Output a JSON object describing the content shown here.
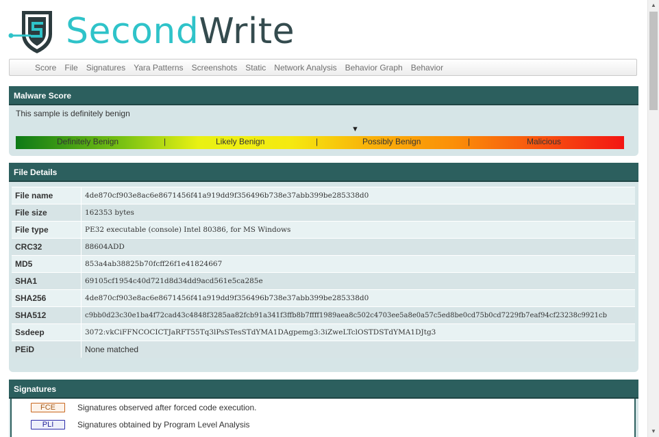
{
  "logo": {
    "part1": "Second",
    "part2": "Write"
  },
  "nav": {
    "items": [
      "Score",
      "File",
      "Signatures",
      "Yara Patterns",
      "Screenshots",
      "Static",
      "Network Analysis",
      "Behavior Graph",
      "Behavior"
    ]
  },
  "malware_score": {
    "title": "Malware Score",
    "summary": "This sample is definitely benign",
    "marker": "▼",
    "levels": [
      "Definitely Benign",
      "Likely Benign",
      "Possibly Benign",
      "Malicious"
    ],
    "separator": "|",
    "colors": {
      "start": "#0d7a16",
      "mid": "#f5ea10",
      "end": "#f31513"
    }
  },
  "file_details": {
    "title": "File Details",
    "rows": [
      {
        "key": "File name",
        "value": "4de870cf903e8ac6e8671456f41a919dd9f356496b738e37abb399be285338d0"
      },
      {
        "key": "File size",
        "value": "162353 bytes"
      },
      {
        "key": "File type",
        "value": "PE32 executable (console) Intel 80386, for MS Windows"
      },
      {
        "key": "CRC32",
        "value": "88604ADD"
      },
      {
        "key": "MD5",
        "value": "853a4ab38825b70fcff26f1e41824667"
      },
      {
        "key": "SHA1",
        "value": "69105cf1954c40d721d8d34dd9acd561e5ca285e"
      },
      {
        "key": "SHA256",
        "value": "4de870cf903e8ac6e8671456f41a919dd9f356496b738e37abb399be285338d0"
      },
      {
        "key": "SHA512",
        "value": "c9bb0d23c30e1ba4f72cad43c4848f3285aa82fcb91a341f3ffb8b7ffff1989aea8c502c4703ee5a8e0a57c5ed8be0cd75b0cd7229fb7eaf94cf23238c9921cb"
      },
      {
        "key": "Ssdeep",
        "value": "3072:vkCiFFNCOCICTJaRFT55Tq3lPsSTesSTdYMA1DAgpemg3:3iZweLTclOSTDSTdYMA1DJtg3"
      },
      {
        "key": "PEiD",
        "value": "None matched"
      }
    ]
  },
  "signatures": {
    "title": "Signatures",
    "legend": [
      {
        "badge": "FCE",
        "desc": "Signatures observed after forced code execution."
      },
      {
        "badge": "PLI",
        "desc": "Signatures obtained by Program Level Analysis"
      }
    ]
  },
  "scrollbar": {
    "up": "▲",
    "down": "▼"
  }
}
